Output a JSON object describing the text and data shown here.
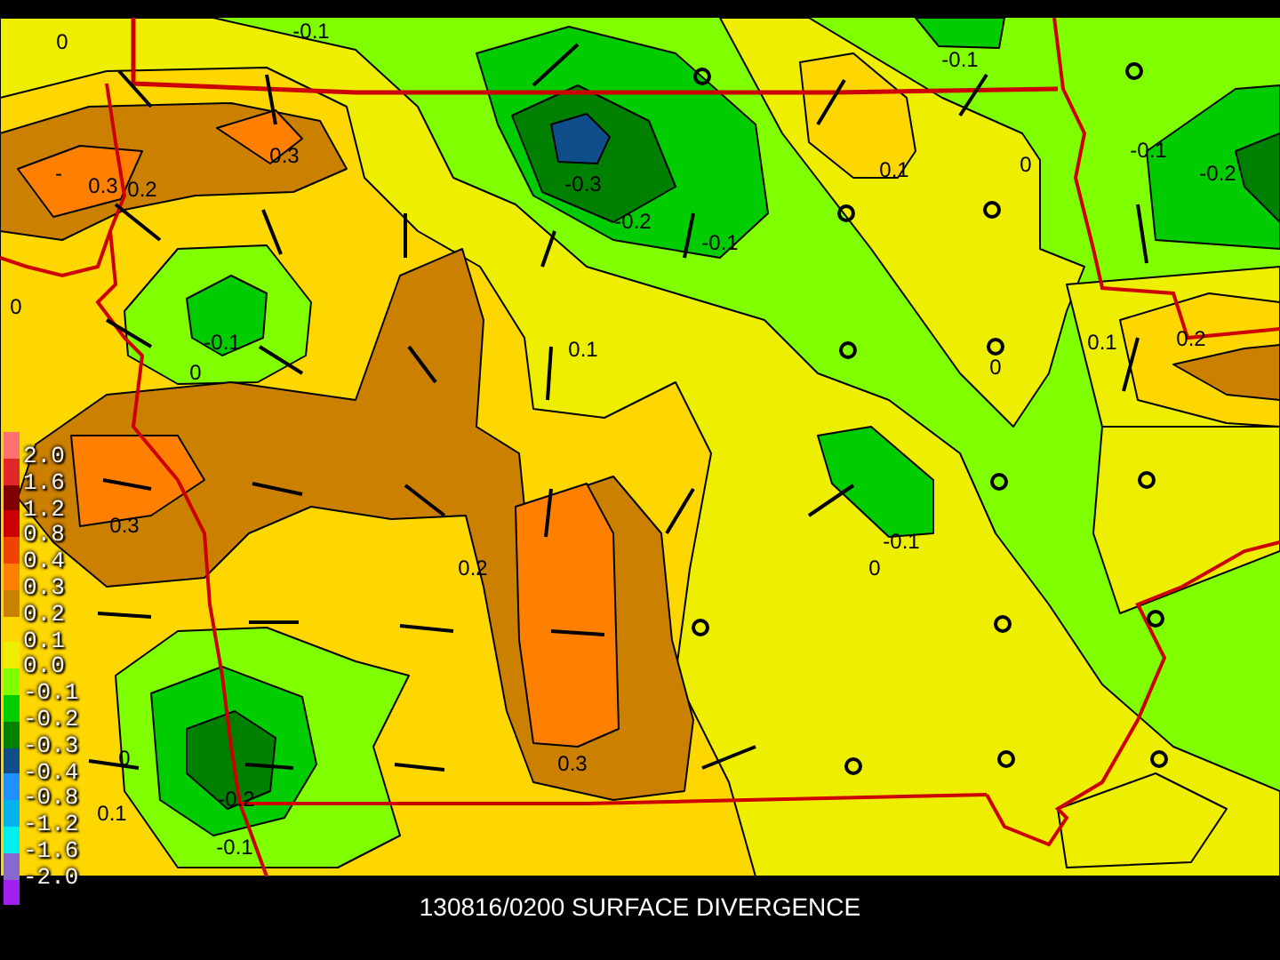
{
  "map": {
    "contour_labels": [
      "-0.1",
      "0",
      "0.3",
      "-",
      "0.3",
      "0.2",
      "-0.3",
      "-0.2",
      "-0.1",
      "-0.1",
      "0",
      "0",
      "0.1",
      "-0.1",
      "0.1",
      "0",
      "-0.1",
      "-0.2",
      "0.1",
      "0.2",
      "0",
      "0.3",
      "0.2",
      "-0.1",
      "0",
      "0.3",
      "0",
      "-0.2",
      "-0.1",
      "0.1"
    ]
  },
  "legend": {
    "swatches": [
      {
        "color": "#ff7070"
      },
      {
        "color": "#e02828"
      },
      {
        "color": "#800000"
      },
      {
        "color": "#cc0000"
      },
      {
        "color": "#ee4400"
      },
      {
        "color": "#ff8000"
      },
      {
        "color": "#cc8000"
      },
      {
        "color": "#ffd700"
      },
      {
        "color": "#eeee00"
      },
      {
        "color": "#80ff00"
      },
      {
        "color": "#00cc00"
      },
      {
        "color": "#008000"
      },
      {
        "color": "#104e8b"
      },
      {
        "color": "#1e90ff"
      },
      {
        "color": "#00b2ee"
      },
      {
        "color": "#00eeee"
      },
      {
        "color": "#8968cd"
      },
      {
        "color": "#a020f0"
      }
    ],
    "labels": [
      "2.0",
      "1.6",
      "1.2",
      "0.8",
      "0.4",
      "0.3",
      "0.2",
      "0.1",
      "0.0",
      "-0.1",
      "-0.2",
      "-0.3",
      "-0.4",
      "-0.8",
      "-1.2",
      "-1.6",
      "-2.0"
    ]
  },
  "caption": "130816/0200 SURFACE DIVERGENCE"
}
